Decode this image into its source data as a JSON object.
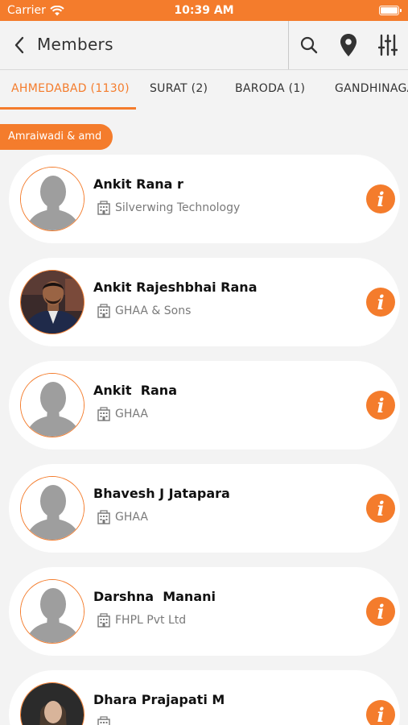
{
  "status_bar": {
    "carrier": "Carrier",
    "time": "10:39 AM"
  },
  "header": {
    "title": "Members"
  },
  "tabs": [
    {
      "label": "AHMEDABAD (1130)",
      "active": true
    },
    {
      "label": "SURAT (2)"
    },
    {
      "label": "BARODA (1)"
    },
    {
      "label": "GANDHINAGAR"
    }
  ],
  "group_chip": "Amraiwadi & amd",
  "members": [
    {
      "name": "Ankit Rana r",
      "company": "Silverwing Technology",
      "photo": "placeholder"
    },
    {
      "name": "Ankit Rajeshbhai Rana",
      "company": "GHAA & Sons",
      "photo": "photo"
    },
    {
      "name": "Ankit  Rana",
      "company": "GHAA",
      "photo": "placeholder"
    },
    {
      "name": "Bhavesh J Jatapara",
      "company": "GHAA",
      "photo": "placeholder"
    },
    {
      "name": "Darshna  Manani",
      "company": "FHPL Pvt Ltd",
      "photo": "placeholder"
    },
    {
      "name": "Dhara Prajapati M",
      "company": "",
      "photo": "photo"
    }
  ],
  "colors": {
    "accent": "#f47c2c",
    "background": "#f3f3f3"
  },
  "icons": [
    "wifi-icon",
    "battery-icon",
    "back-chevron-icon",
    "search-icon",
    "location-pin-icon",
    "filter-sliders-icon",
    "building-icon",
    "info-icon"
  ]
}
